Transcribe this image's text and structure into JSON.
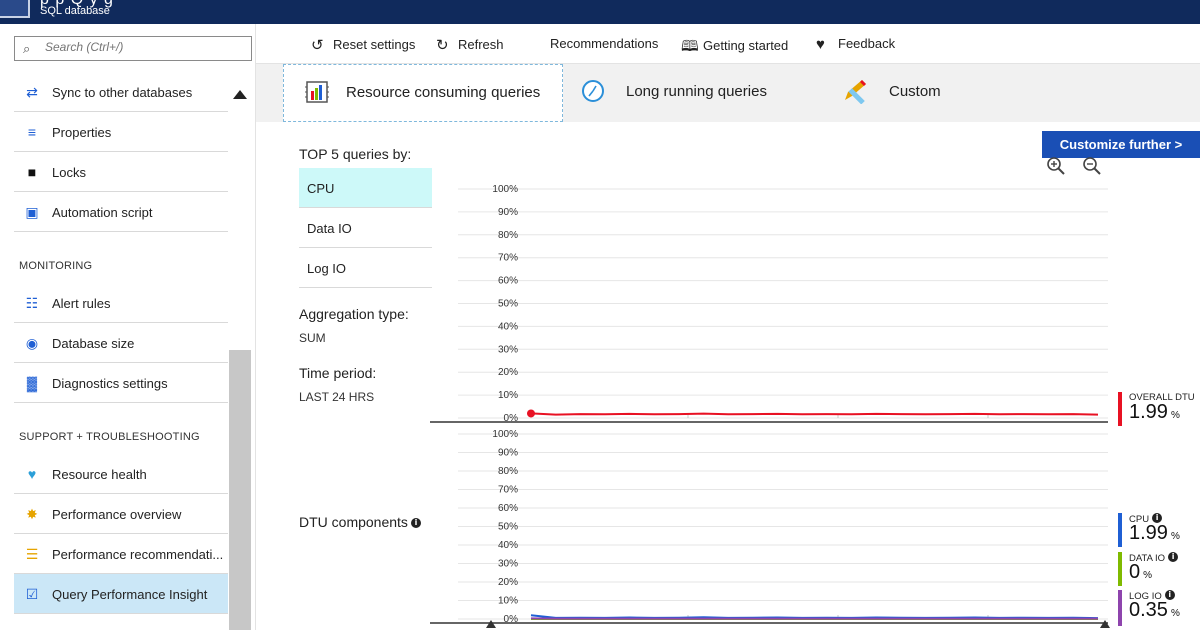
{
  "header": {
    "title_fragment": "p          p   Q y         g",
    "subtitle": "SQL database"
  },
  "sidebar": {
    "search_placeholder": "Search (Ctrl+/)",
    "items_top": [
      {
        "label": "Sync to other databases",
        "icon": "sync-icon"
      },
      {
        "label": "Properties",
        "icon": "properties-icon"
      },
      {
        "label": "Locks",
        "icon": "lock-icon"
      },
      {
        "label": "Automation script",
        "icon": "automation-script-icon"
      }
    ],
    "monitoring_header": "MONITORING",
    "items_monitoring": [
      {
        "label": "Alert rules",
        "icon": "alert-rules-icon"
      },
      {
        "label": "Database size",
        "icon": "database-size-icon"
      },
      {
        "label": "Diagnostics settings",
        "icon": "diagnostics-icon"
      }
    ],
    "support_header": "SUPPORT + TROUBLESHOOTING",
    "items_support": [
      {
        "label": "Resource health",
        "icon": "heart-icon"
      },
      {
        "label": "Performance overview",
        "icon": "performance-overview-icon"
      },
      {
        "label": "Performance recommendati...",
        "icon": "performance-recommendations-icon"
      },
      {
        "label": "Query Performance Insight",
        "icon": "query-insight-icon"
      }
    ]
  },
  "toolbar": {
    "reset": "Reset settings",
    "refresh": "Refresh",
    "recommendations": "Recommendations",
    "getting_started": "Getting started",
    "feedback": "Feedback"
  },
  "tabs": {
    "resource": "Resource consuming queries",
    "long": "Long running queries",
    "custom": "Custom"
  },
  "customize_button": "Customize further >",
  "panel": {
    "top5_label": "TOP 5 queries by:",
    "metrics": [
      "CPU",
      "Data IO",
      "Log IO"
    ],
    "selected_metric": "CPU",
    "aggregation_label": "Aggregation type:",
    "aggregation_value": "SUM",
    "time_label": "Time period:",
    "time_value": "LAST 24 HRS",
    "dtu_label": "DTU components",
    "info_glyph": "i"
  },
  "chart_data": [
    {
      "type": "line",
      "ylim": [
        0,
        100
      ],
      "y_ticks": [
        "0%",
        "10%",
        "20%",
        "30%",
        "40%",
        "50%",
        "60%",
        "70%",
        "80%",
        "90%",
        "100%"
      ],
      "series": [
        {
          "name": "OVERALL DTU",
          "color": "#e81123",
          "values": [
            1.99,
            1.5,
            1.7,
            1.6,
            1.8,
            1.6,
            1.7,
            1.9,
            1.6,
            1.7,
            1.8,
            1.6,
            1.7,
            1.6,
            1.8,
            1.7,
            1.6,
            1.7,
            1.8,
            1.6,
            1.7,
            1.6,
            1.7,
            1.5
          ]
        }
      ]
    },
    {
      "type": "line",
      "ylim": [
        0,
        100
      ],
      "y_ticks": [
        "0%",
        "10%",
        "20%",
        "30%",
        "40%",
        "50%",
        "60%",
        "70%",
        "80%",
        "90%",
        "100%"
      ],
      "series": [
        {
          "name": "CPU",
          "color": "#1f5fd4",
          "values": [
            1.99,
            0.6,
            0.7,
            0.6,
            0.8,
            0.6,
            0.7,
            0.9,
            0.6,
            0.7,
            0.8,
            0.6,
            0.7,
            0.6,
            0.8,
            0.7,
            0.6,
            0.7,
            0.8,
            0.6,
            0.7,
            0.6,
            0.7,
            0.5
          ]
        },
        {
          "name": "DATA IO",
          "color": "#7fba00",
          "values": [
            0,
            0,
            0,
            0,
            0,
            0,
            0,
            0,
            0,
            0,
            0,
            0,
            0,
            0,
            0,
            0,
            0,
            0,
            0,
            0,
            0,
            0,
            0,
            0
          ]
        },
        {
          "name": "LOG IO",
          "color": "#8e44ad",
          "values": [
            0.35,
            0.2,
            0.2,
            0.2,
            0.2,
            0.2,
            0.2,
            0.2,
            0.2,
            0.2,
            0.2,
            0.2,
            0.2,
            0.2,
            0.2,
            0.2,
            0.2,
            0.2,
            0.2,
            0.2,
            0.2,
            0.2,
            0.2,
            0.2
          ]
        }
      ]
    }
  ],
  "legend": {
    "overall": {
      "name": "OVERALL DTU",
      "value": "1.99",
      "unit": "%",
      "color": "#e81123"
    },
    "cpu": {
      "name": "CPU",
      "value": "1.99",
      "unit": "%",
      "color": "#1f5fd4"
    },
    "data_io": {
      "name": "DATA IO",
      "value": "0",
      "unit": "%",
      "color": "#7fba00"
    },
    "log_io": {
      "name": "LOG IO",
      "value": "0.35",
      "unit": "%",
      "color": "#8e44ad"
    }
  }
}
